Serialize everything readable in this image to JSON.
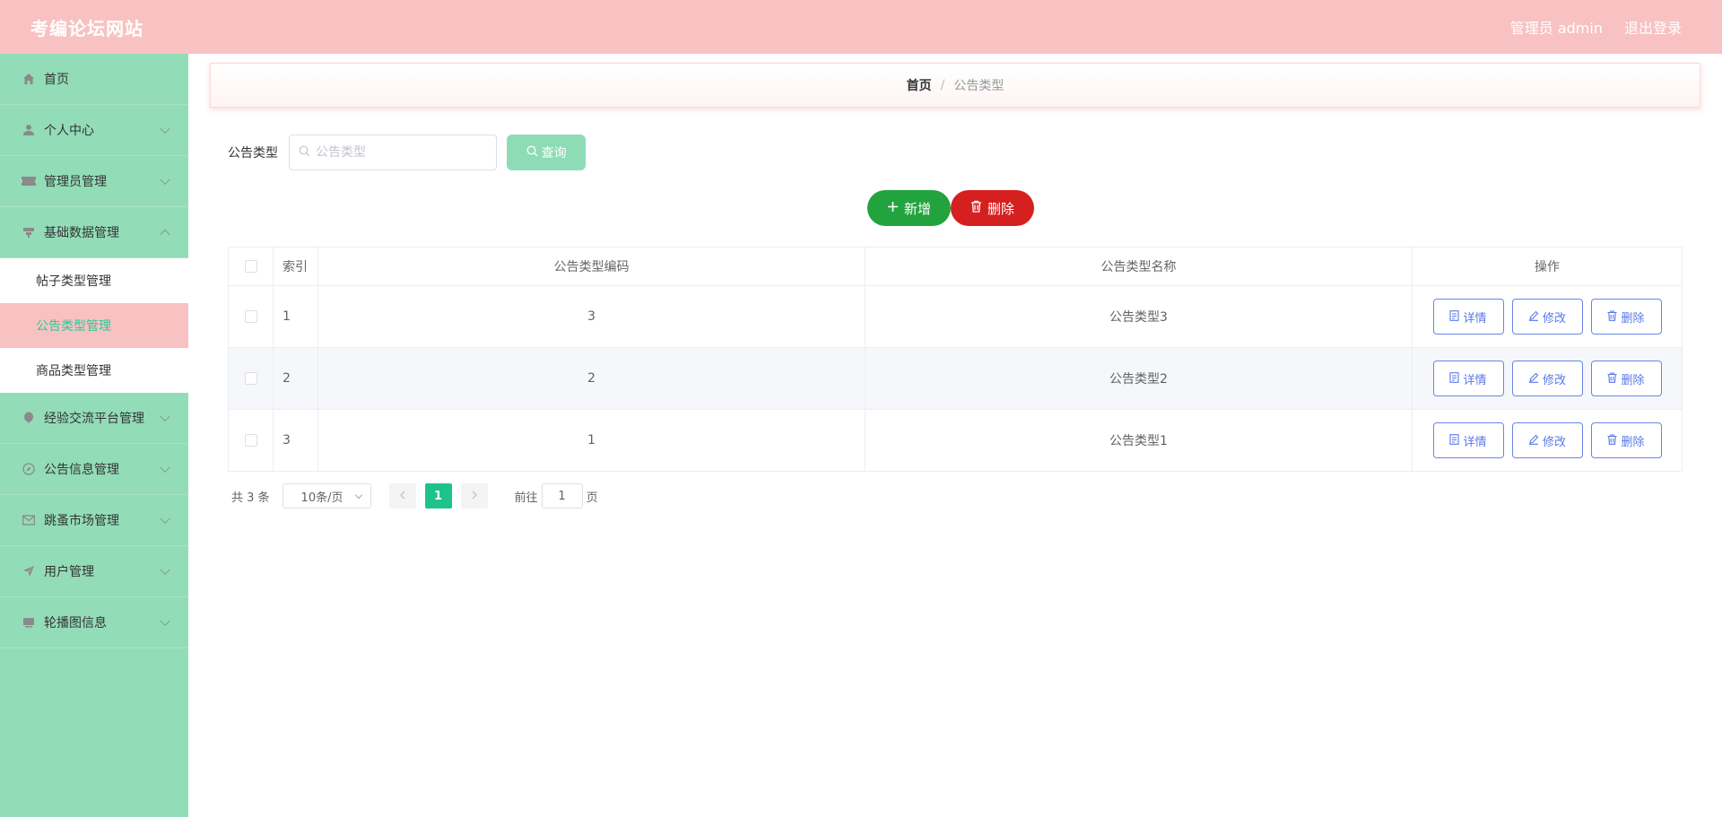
{
  "header": {
    "title": "考编论坛网站",
    "user_label": "管理员 admin",
    "logout_label": "退出登录"
  },
  "sidebar": {
    "items": [
      {
        "label": "首页",
        "icon": "home-icon"
      },
      {
        "label": "个人中心",
        "icon": "user-icon"
      },
      {
        "label": "管理员管理",
        "icon": "ticket-icon"
      },
      {
        "label": "基础数据管理",
        "icon": "data-icon",
        "expanded": true,
        "children": [
          {
            "label": "帖子类型管理"
          },
          {
            "label": "公告类型管理",
            "active": true
          },
          {
            "label": "商品类型管理"
          }
        ]
      },
      {
        "label": "经验交流平台管理",
        "icon": "balloon-icon"
      },
      {
        "label": "公告信息管理",
        "icon": "compass-icon"
      },
      {
        "label": "跳蚤市场管理",
        "icon": "mail-icon"
      },
      {
        "label": "用户管理",
        "icon": "send-icon"
      },
      {
        "label": "轮播图信息",
        "icon": "monitor-icon"
      }
    ]
  },
  "breadcrumb": {
    "home": "首页",
    "separator": "/",
    "current": "公告类型"
  },
  "search": {
    "label": "公告类型",
    "placeholder": "公告类型",
    "value": "",
    "button_label": "查询"
  },
  "toolbar": {
    "add_label": "新增",
    "delete_label": "删除"
  },
  "table": {
    "headers": {
      "index": "索引",
      "code": "公告类型编码",
      "name": "公告类型名称",
      "ops": "操作"
    },
    "rows": [
      {
        "index": "1",
        "code": "3",
        "name": "公告类型3"
      },
      {
        "index": "2",
        "code": "2",
        "name": "公告类型2"
      },
      {
        "index": "3",
        "code": "1",
        "name": "公告类型1"
      }
    ],
    "row_actions": {
      "detail": "详情",
      "edit": "修改",
      "delete": "删除"
    }
  },
  "pagination": {
    "total_text": "共 3 条",
    "page_size": "10条/页",
    "current_page": "1",
    "goto_prefix": "前往",
    "goto_value": "1",
    "goto_suffix": "页"
  },
  "colors": {
    "header_bg": "#f8c2c2",
    "sidebar_bg": "#93dcb8",
    "add_button": "#23a33e",
    "delete_button": "#d61f1f",
    "active_page": "#1ec28b",
    "op_button_border": "#6a84e8"
  }
}
